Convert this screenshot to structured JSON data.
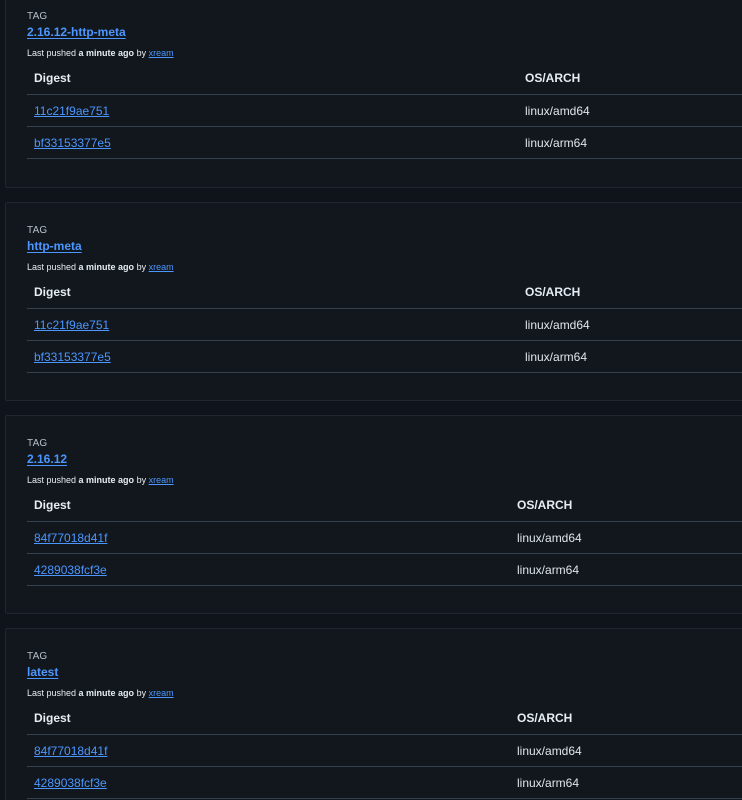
{
  "tags": [
    {
      "label": "TAG",
      "name": "2.16.12-http-meta",
      "pushed_prefix": "Last pushed ",
      "pushed_time": "a minute ago",
      "pushed_by": " by ",
      "user": "xream",
      "col_digest": "Digest",
      "col_osarch": "OS/ARCH",
      "rows": [
        {
          "digest": "11c21f9ae751",
          "osarch": "linux/amd64"
        },
        {
          "digest": "bf33153377e5",
          "osarch": "linux/arm64"
        }
      ]
    },
    {
      "label": "TAG",
      "name": "http-meta",
      "pushed_prefix": "Last pushed ",
      "pushed_time": "a minute ago",
      "pushed_by": " by ",
      "user": "xream",
      "col_digest": "Digest",
      "col_osarch": "OS/ARCH",
      "rows": [
        {
          "digest": "11c21f9ae751",
          "osarch": "linux/amd64"
        },
        {
          "digest": "bf33153377e5",
          "osarch": "linux/arm64"
        }
      ]
    },
    {
      "label": "TAG",
      "name": "2.16.12",
      "pushed_prefix": "Last pushed ",
      "pushed_time": "a minute ago",
      "pushed_by": " by ",
      "user": "xream",
      "col_digest": "Digest",
      "col_osarch": "OS/ARCH",
      "rows": [
        {
          "digest": "84f77018d41f",
          "osarch": "linux/amd64"
        },
        {
          "digest": "4289038fcf3e",
          "osarch": "linux/arm64"
        }
      ]
    },
    {
      "label": "TAG",
      "name": "latest",
      "pushed_prefix": "Last pushed ",
      "pushed_time": "a minute ago",
      "pushed_by": " by ",
      "user": "xream",
      "col_digest": "Digest",
      "col_osarch": "OS/ARCH",
      "rows": [
        {
          "digest": "84f77018d41f",
          "osarch": "linux/amd64"
        },
        {
          "digest": "4289038fcf3e",
          "osarch": "linux/arm64"
        }
      ]
    }
  ]
}
